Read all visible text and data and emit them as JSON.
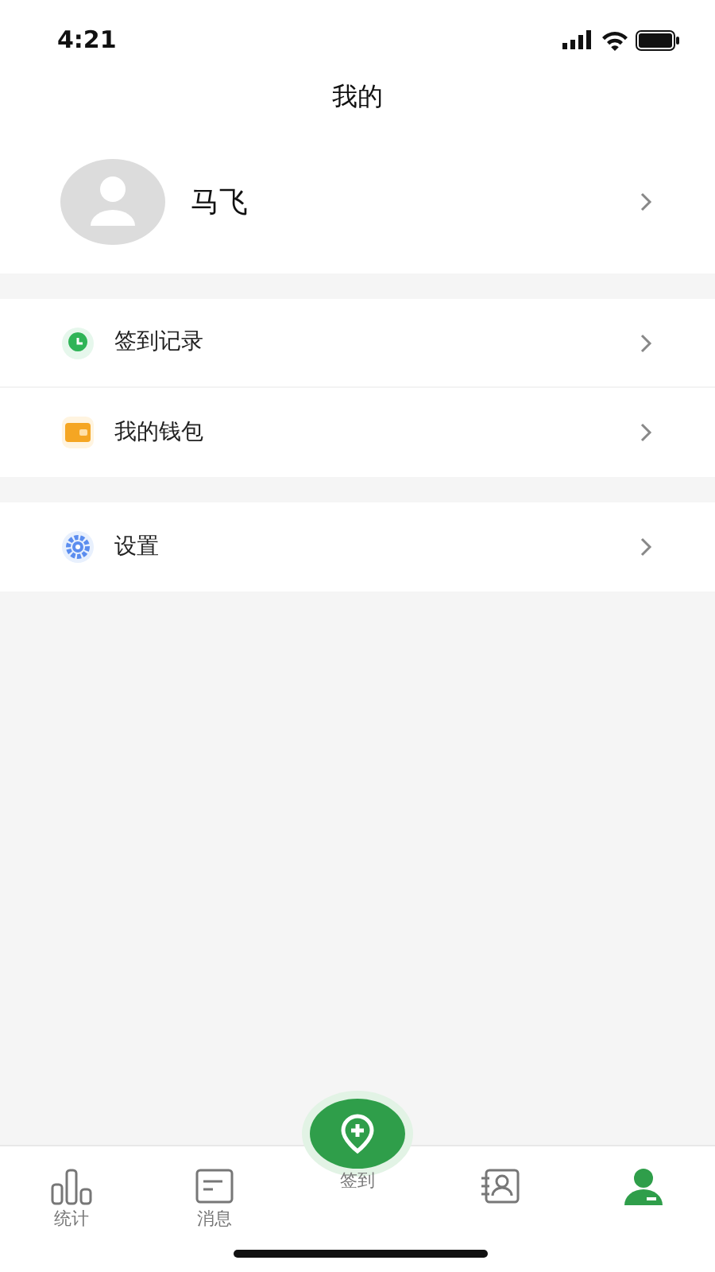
{
  "status_bar": {
    "time": "4:21"
  },
  "title": "我的",
  "profile": {
    "name": "马飞"
  },
  "menu_groups": [
    {
      "items": [
        {
          "label": "签到记录"
        },
        {
          "label": "我的钱包"
        }
      ]
    },
    {
      "items": [
        {
          "label": "设置"
        }
      ]
    }
  ],
  "tab_bar": [
    {
      "label": "统计",
      "selected": false
    },
    {
      "label": "消息",
      "selected": false
    },
    {
      "label": "签到",
      "selected": false
    },
    {
      "selected": false
    },
    {
      "selected": true
    }
  ]
}
